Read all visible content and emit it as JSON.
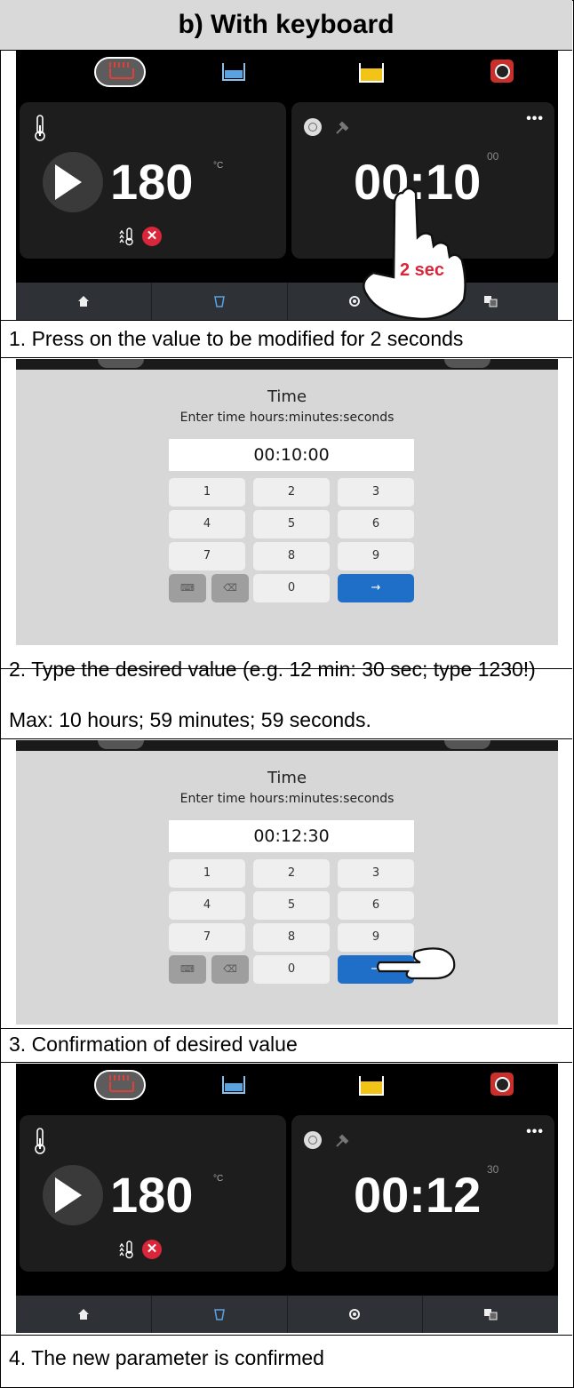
{
  "header": {
    "title": "b)  With keyboard"
  },
  "screen": {
    "temperature": "180",
    "temp_unit": "°C",
    "more": "•••",
    "timer_initial": "00:10",
    "timer_initial_seconds": "00",
    "timer_final": "00:12",
    "timer_final_seconds": "30",
    "press_label": "2 sec",
    "close_glyph": "✕",
    "icons": [
      "heating-bath-icon",
      "water-bath-icon",
      "yellow-bath-icon",
      "timer-device-icon",
      "thermometer-icon",
      "play-icon",
      "temperature-ramp-icon",
      "error-icon",
      "gauge-icon",
      "hammer-icon",
      "home-icon",
      "bath-nav-icon",
      "settings-nav-icon",
      "language-nav-icon"
    ],
    "accent_colors": {
      "red": "#d9263a",
      "blue_key": "#1f6fc9",
      "yellow": "#f3c418",
      "water": "#5ba3e0"
    }
  },
  "dialog": {
    "title": "Time",
    "subtitle": "Enter time hours:minutes:seconds",
    "value_step2": "00:10:00",
    "value_step3": "00:12:30",
    "keys": [
      "1",
      "2",
      "3",
      "4",
      "5",
      "6",
      "7",
      "8",
      "9"
    ],
    "zero": "0",
    "enter": "→",
    "keyboard_glyph": "⌨",
    "backspace_glyph": "⌫"
  },
  "steps": {
    "step1": "1. Press on the value to be modified for 2 seconds",
    "step2": "2. Type the desired value (e.g. 12 min: 30 sec; type 1230!)",
    "step2_max": "Max: 10 hours; 59 minutes; 59 seconds.",
    "step3": "3. Confirmation of desired value",
    "step4": "4. The new parameter is confirmed"
  }
}
